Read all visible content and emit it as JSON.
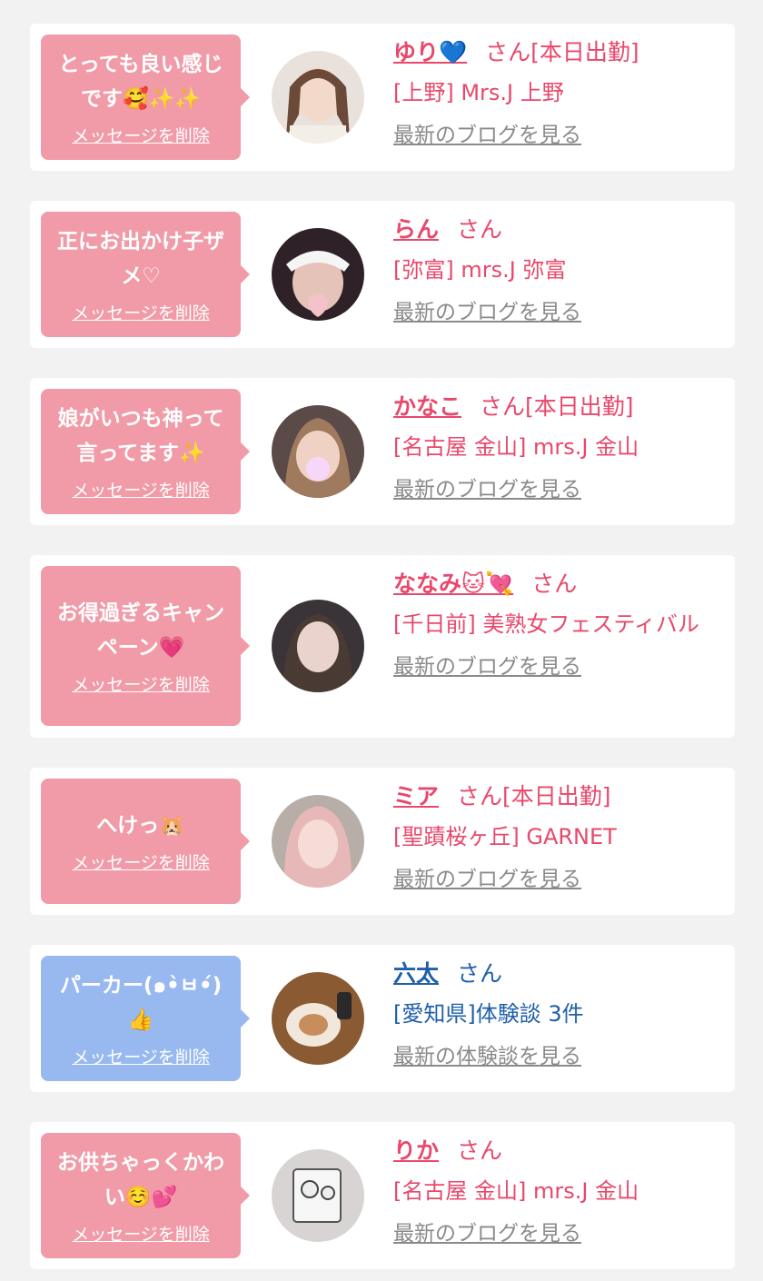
{
  "colors": {
    "pink": "#e8486b",
    "bubble_pink": "#f09ba7",
    "blue": "#1f5fa8",
    "bubble_blue": "#98b8f0",
    "grey_link": "#8a8a8a",
    "card_bg": "#ffffff",
    "page_bg": "#f2f2f2"
  },
  "cards": [
    {
      "bubble_text": "とっても良い感じです🥰✨✨",
      "delete_label": "メッセージを削除",
      "name": "ゆり💙",
      "suffix": "さん[本日出勤]",
      "shop": "[上野] Mrs.J 上野",
      "link": "最新のブログを見る",
      "theme": "pink"
    },
    {
      "bubble_text": "正にお出かけ子ザメ♡",
      "delete_label": "メッセージを削除",
      "name": "らん",
      "suffix": "さん",
      "shop": "[弥富] mrs.J 弥富",
      "link": "最新のブログを見る",
      "theme": "pink"
    },
    {
      "bubble_text": "娘がいつも神って言ってます✨",
      "delete_label": "メッセージを削除",
      "name": "かなこ",
      "suffix": "さん[本日出勤]",
      "shop": "[名古屋 金山] mrs.J 金山",
      "link": "最新のブログを見る",
      "theme": "pink"
    },
    {
      "bubble_text": "お得過ぎるキャンペーン💗",
      "delete_label": "メッセージを削除",
      "name": "ななみ🐱💘",
      "suffix": "さん",
      "shop": "[千日前] 美熟女フェスティバル",
      "link": "最新のブログを見る",
      "theme": "pink"
    },
    {
      "bubble_text": "へけっ🐹",
      "delete_label": "メッセージを削除",
      "name": "ミア",
      "suffix": "さん[本日出勤]",
      "shop": "[聖蹟桜ヶ丘] GARNET",
      "link": "最新のブログを見る",
      "theme": "pink"
    },
    {
      "bubble_text": "パーカー(๑•̀ㅂ•́)👍",
      "delete_label": "メッセージを削除",
      "name": "六太",
      "suffix": "さん",
      "shop": "[愛知県]体験談 3件",
      "link": "最新の体験談を見る",
      "theme": "blue"
    },
    {
      "bubble_text": "お供ちゃっくかわい☺️💕",
      "delete_label": "メッセージを削除",
      "name": "りか",
      "suffix": "さん",
      "shop": "[名古屋 金山] mrs.J 金山",
      "link": "最新のブログを見る",
      "theme": "pink"
    }
  ]
}
